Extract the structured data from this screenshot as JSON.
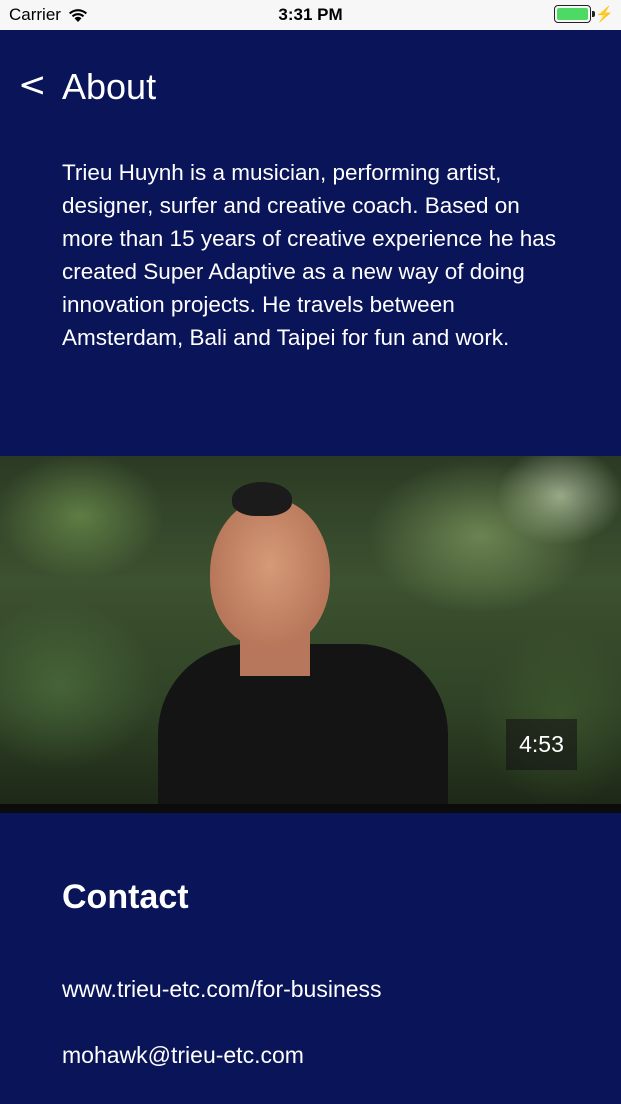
{
  "status_bar": {
    "carrier": "Carrier",
    "wifi_icon": "wifi-icon",
    "time": "3:31 PM",
    "battery_level": 1.0,
    "battery_color": "#4cd964",
    "charging_icon": "bolt-icon",
    "charging_glyph": "⚡"
  },
  "nav": {
    "back_glyph": "<",
    "back_icon": "chevron-left-icon",
    "title": "About"
  },
  "about": {
    "bio": "Trieu Huynh is a musician, performing artist, designer, surfer and creative coach. Based on more than 15 years of creative experience he has created Super Adaptive as a new way of doing innovation projects. He travels between Amsterdam, Bali and Taipei for fun and work."
  },
  "video": {
    "duration": "4:53"
  },
  "contact": {
    "title": "Contact",
    "website": "www.trieu-etc.com/for-business",
    "email": "mohawk@trieu-etc.com"
  },
  "colors": {
    "background": "#0a1458",
    "text": "#ffffff",
    "status_bar": "#f7f7f7"
  }
}
